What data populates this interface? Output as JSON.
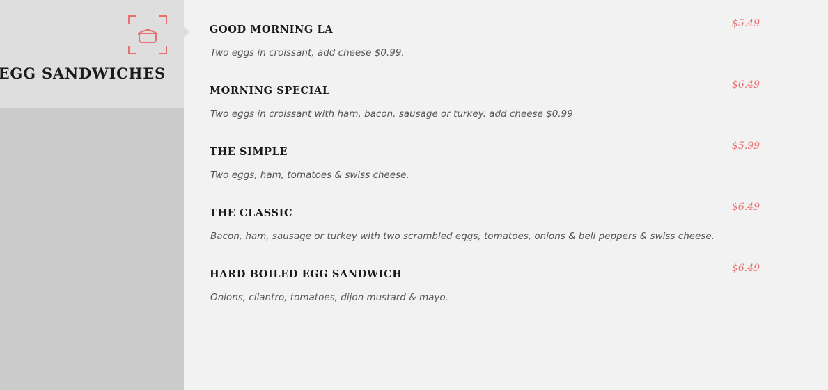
{
  "category": {
    "title": "EGG SANDWICHES",
    "icon": "cooking-pot-icon"
  },
  "colors": {
    "accent": "#e8716f",
    "sidebar": "#cbcbcb",
    "card": "#dedede",
    "background": "#f2f2f2"
  },
  "items": [
    {
      "name": "GOOD MORNING LA",
      "description": "Two eggs in croissant, add cheese $0.99.",
      "price": "$5.49"
    },
    {
      "name": "MORNING SPECIAL",
      "description": "Two eggs in croissant with ham, bacon, sausage or turkey. add cheese $0.99",
      "price": "$6.49"
    },
    {
      "name": "THE SIMPLE",
      "description": "Two eggs, ham, tomatoes & swiss cheese.",
      "price": "$5.99"
    },
    {
      "name": "THE CLASSIC",
      "description": "Bacon, ham, sausage or turkey with two scrambled eggs, tomatoes, onions & bell peppers & swiss cheese.",
      "price": "$6.49"
    },
    {
      "name": "HARD BOILED EGG SANDWICH",
      "description": "Onions, cilantro, tomatoes, dijon mustard & mayo.",
      "price": "$6.49"
    }
  ]
}
